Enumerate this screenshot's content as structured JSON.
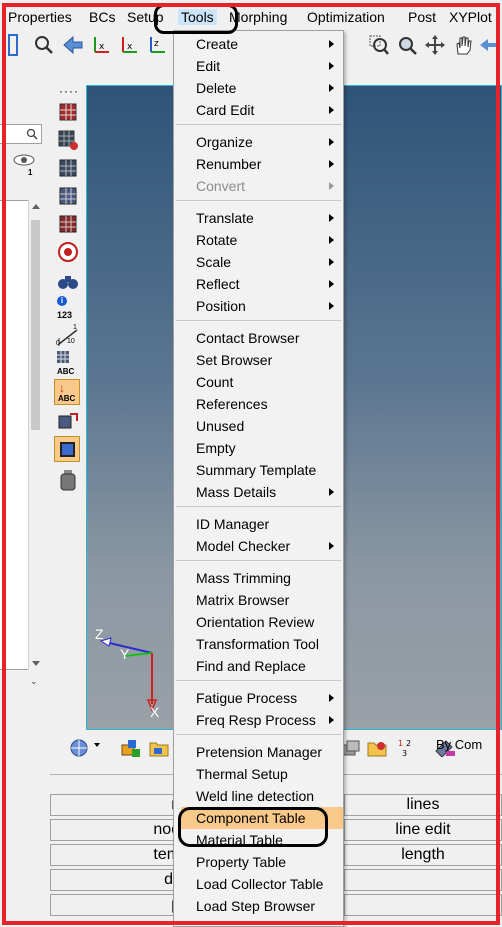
{
  "menubar": [
    "Properties",
    "BCs",
    "Setup",
    "Tools",
    "Morphing",
    "Optimization",
    "Post",
    "XYPlot"
  ],
  "tools_menu": {
    "items": [
      {
        "label": "Create",
        "submenu": true
      },
      {
        "label": "Edit",
        "submenu": true
      },
      {
        "label": "Delete",
        "submenu": true
      },
      {
        "label": "Card Edit",
        "submenu": true
      },
      {
        "label": "Organize",
        "submenu": true
      },
      {
        "label": "Renumber",
        "submenu": true
      },
      {
        "label": "Convert",
        "submenu": true,
        "disabled": true
      },
      {
        "label": "Translate",
        "submenu": true
      },
      {
        "label": "Rotate",
        "submenu": true
      },
      {
        "label": "Scale",
        "submenu": true
      },
      {
        "label": "Reflect",
        "submenu": true
      },
      {
        "label": "Position",
        "submenu": true
      },
      {
        "label": "Contact Browser"
      },
      {
        "label": "Set Browser"
      },
      {
        "label": "Count"
      },
      {
        "label": "References"
      },
      {
        "label": "Unused"
      },
      {
        "label": "Empty"
      },
      {
        "label": "Summary Template"
      },
      {
        "label": "Mass Details",
        "submenu": true
      },
      {
        "label": "ID Manager"
      },
      {
        "label": "Model Checker",
        "submenu": true
      },
      {
        "label": "Mass Trimming"
      },
      {
        "label": "Matrix Browser"
      },
      {
        "label": "Orientation Review"
      },
      {
        "label": "Transformation Tool"
      },
      {
        "label": "Find and Replace"
      },
      {
        "label": "Fatigue Process",
        "submenu": true
      },
      {
        "label": "Freq Resp Process",
        "submenu": true
      },
      {
        "label": "Pretension Manager"
      },
      {
        "label": "Thermal Setup"
      },
      {
        "label": "Weld line detection"
      },
      {
        "label": "Component Table",
        "highlighted": true
      },
      {
        "label": "Material Table"
      },
      {
        "label": "Property Table"
      },
      {
        "label": "Load Collector Table"
      },
      {
        "label": "Load Step Browser"
      }
    ]
  },
  "left_panel": {
    "visibility_count": "1"
  },
  "vertical_toolbar": {
    "info_label": "123",
    "abc_label": "ABC",
    "abc_label_2": "ABC",
    "scale_0": "0",
    "scale_1": "1",
    "scale_10": "10"
  },
  "viewport": {
    "axis_z": "Z",
    "axis_y": "Y",
    "axis_x": "X"
  },
  "bottom_toolbar": {
    "by_comp": "By Com"
  },
  "bottom_panel": {
    "left_col": [
      "no",
      "node",
      "temp",
      "dist",
      "po"
    ],
    "right_col": [
      "lines",
      "line edit",
      "length"
    ]
  },
  "colors": {
    "highlight": "#f9c98a",
    "annotation_frame": "#e5232a",
    "viewport_border": "#29b6d8"
  }
}
